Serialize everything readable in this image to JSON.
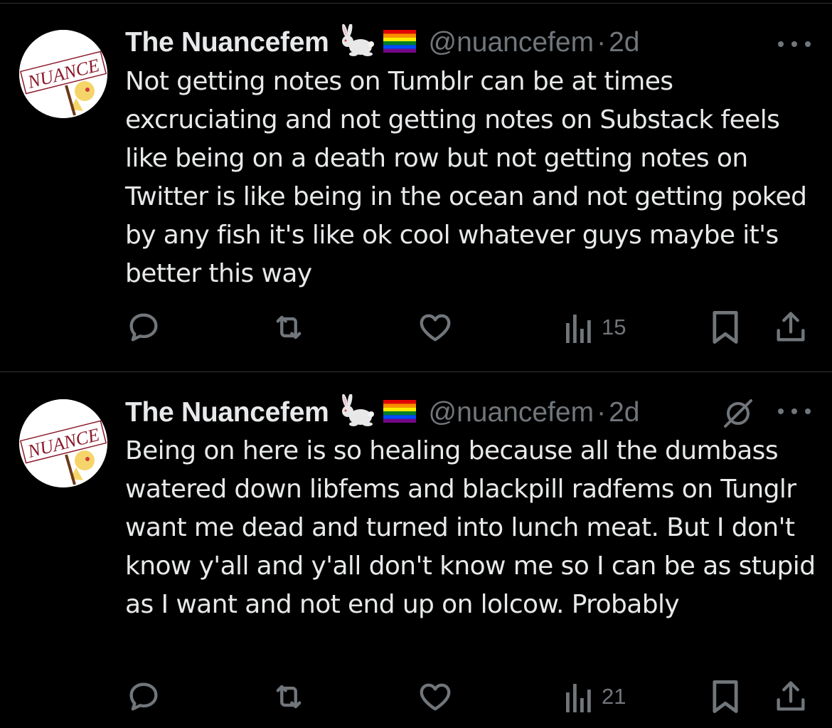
{
  "tweets": [
    {
      "display_name": "The Nuancefem",
      "emoji_1": "rabbit",
      "emoji_2": "rainbow-flag",
      "handle": "@nuancefem",
      "separator": "·",
      "time": "2d",
      "avatar_text": "NUANCE",
      "text": "Not getting notes on Tumblr can be at times excruciating and not getting notes on Substack feels like being on a death row but not getting notes on Twitter is like being in the ocean and not getting poked by any fish it's like ok cool whatever guys maybe it's better this way",
      "views": "15",
      "has_grok_icon": false
    },
    {
      "display_name": "The Nuancefem",
      "emoji_1": "rabbit",
      "emoji_2": "rainbow-flag",
      "handle": "@nuancefem",
      "separator": "·",
      "time": "2d",
      "avatar_text": "NUANCE",
      "text": "Being on here is so healing because all the dumbass watered down libfems and blackpill radfems on Tunglr want me dead and turned into lunch meat. But I don't know y'all and y'all don't know me so I can be as stupid as I want and not end up on lolcow. Probably",
      "views": "21",
      "has_grok_icon": true
    }
  ],
  "colors": {
    "background": "#000000",
    "text_primary": "#e7e9ea",
    "text_secondary": "#71767b",
    "divider": "#2f3336",
    "avatar_text": "#8b1a2b"
  }
}
